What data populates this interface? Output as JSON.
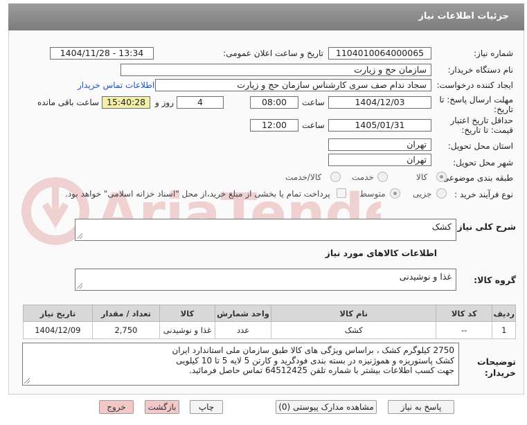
{
  "header": {
    "title": "جزئیات اطلاعات نیاز"
  },
  "fields": {
    "need_number_label": "شماره نیاز:",
    "need_number": "1104010064000065",
    "announce_label": "تاریخ و ساعت اعلان عمومی:",
    "announce_value": "1404/11/28 - 13:34",
    "buyer_org_label": "نام دستگاه خریدار:",
    "buyer_org": "سازمان حج و زیارت",
    "creator_label": "ایجاد کننده درخواست:",
    "creator": "سجاد ندام صف سری کارشناس سازمان حج و زیارت",
    "contact_link": "اطلاعات تماس خریدار",
    "deadline_label_1": "مهلت ارسال پاسخ: تا",
    "deadline_label_2": "تاریخ:",
    "deadline_date": "1404/12/03",
    "time_label": "ساعت",
    "deadline_time": "08:00",
    "days_value": "4",
    "days_label": "روز و",
    "remaining_time": "15:40:28",
    "remaining_label": "ساعت باقی مانده",
    "validity_label_1": "حداقل تاریخ اعتبار",
    "validity_label_2": "قیمت: تا تاریخ:",
    "validity_date": "1405/01/31",
    "validity_time": "12:00",
    "province_label": "استان محل تحویل:",
    "province": "تهران",
    "city_label": "شهر محل تحویل:",
    "city": "تهران",
    "category_label": "طبقه بندی موضوعی:",
    "category_options": [
      "کالا",
      "خدمت",
      "کالا/خدمت"
    ],
    "process_label": "نوع فرآیند خرید :",
    "process_options": [
      "جزیی",
      "متوسط"
    ],
    "payment_note": "پرداخت تمام یا بخشی از مبلغ خرید،از محل \"اسناد خزانه اسلامی\" خواهد بود."
  },
  "description": {
    "label": "شرح کلی نیاز:",
    "value": "کشک"
  },
  "goods_info_title": "اطلاعات کالاهای مورد نیاز",
  "goods_group": {
    "label": "گروه کالا:",
    "value": "غذا و نوشیدنی"
  },
  "table": {
    "headers": [
      "ردیف",
      "کد کالا",
      "نام کالا",
      "واحد شمارش",
      "کالا",
      "تعداد / مقدار",
      "تاریخ نیاز"
    ],
    "rows": [
      [
        "1",
        "--",
        "کشک",
        "عدد",
        "غذا و نوشیدنی",
        "2,750",
        "1404/12/09"
      ]
    ]
  },
  "buyer_notes": {
    "label_1": "توضیحات",
    "label_2": "خریدار:",
    "lines": [
      "2750 کیلوگرم کشک ، براساس ویژگی های کالا طبق سازمان ملی استاندارد ایران",
      "کشک پاستوریزه و هموژنیزه در بسته بندی فودگرید و کارتن 5 لایه 5 تا 10  کیلویی",
      "جهت کسب اطلاعات بیشتر با شماره تلفن 64512425 تماس حاصل فرمائید."
    ]
  },
  "buttons": {
    "respond": "پاسخ به نیاز",
    "attachments": "مشاهده مدارک پیوستی (0)",
    "print": "چاپ",
    "back": "بازگشت",
    "exit": "خروج"
  },
  "colors": {
    "header_bg": "#8c8c8c",
    "link": "#1a55c8",
    "exit_button": "#f4c8c8",
    "remaining_time_bg": "#f4f0a8"
  }
}
